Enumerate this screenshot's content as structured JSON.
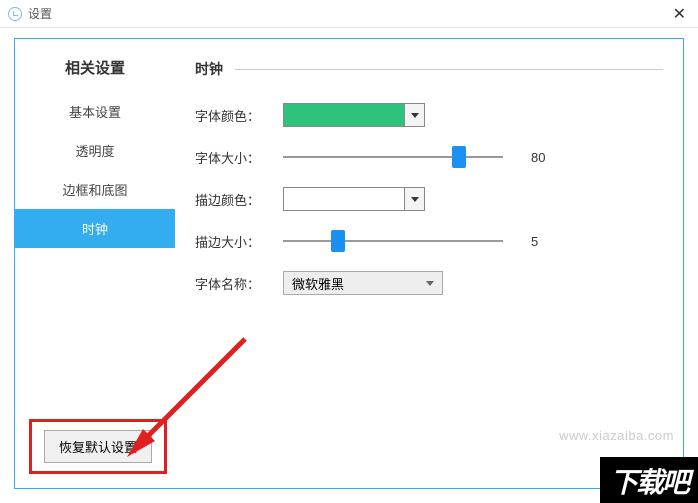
{
  "window": {
    "title": "设置"
  },
  "sidebar": {
    "heading": "相关设置",
    "items": [
      {
        "label": "基本设置",
        "active": false
      },
      {
        "label": "透明度",
        "active": false
      },
      {
        "label": "边框和底图",
        "active": false
      },
      {
        "label": "时钟",
        "active": true
      }
    ],
    "restore_button": "恢复默认设置"
  },
  "content": {
    "section_title": "时钟",
    "font_color": {
      "label": "字体颜色：",
      "value": "#2dc37c"
    },
    "font_size": {
      "label": "字体大小：",
      "value": 80,
      "min": 0,
      "max": 100
    },
    "stroke_color": {
      "label": "描边颜色：",
      "value": "#ffffff"
    },
    "stroke_size": {
      "label": "描边大小：",
      "value": 5,
      "min": 0,
      "max": 20
    },
    "font_name": {
      "label": "字体名称：",
      "value": "微软雅黑"
    }
  },
  "watermark": "www.xiazaiba.com",
  "logo": "下载吧"
}
